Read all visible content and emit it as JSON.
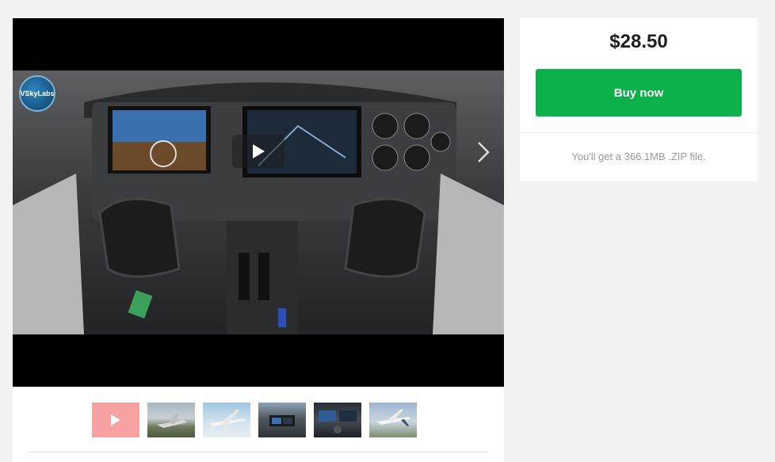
{
  "video": {
    "logo_text": "VSkyLabs",
    "play_icon": "play-icon",
    "next_icon": "chevron-right-icon"
  },
  "thumbnails": [
    {
      "kind": "video",
      "icon": "play-icon"
    },
    {
      "kind": "image"
    },
    {
      "kind": "image"
    },
    {
      "kind": "image"
    },
    {
      "kind": "image"
    },
    {
      "kind": "image"
    }
  ],
  "purchase": {
    "price": "$28.50",
    "buy_label": "Buy now",
    "file_note": "You'll get a 366.1MB .ZIP file."
  },
  "colors": {
    "buy_button": "#0cb04a",
    "video_thumb": "#f7a1a3",
    "page_background": "#f2f2f2"
  }
}
